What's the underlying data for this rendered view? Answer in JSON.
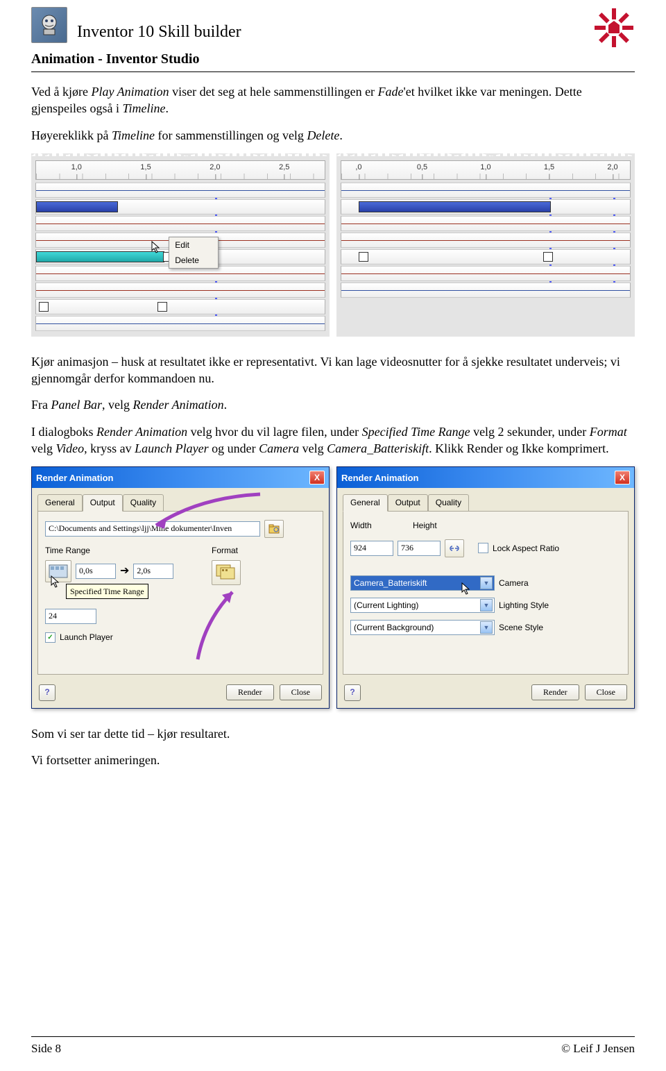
{
  "header": {
    "title": "Inventor 10  Skill builder",
    "subtitle": "Animation - Inventor Studio"
  },
  "body": {
    "p1a": "Ved å kjøre ",
    "p1_play": "Play Animation",
    "p1b": " viser det seg at hele sammenstillingen er ",
    "p1_fade": "Fade",
    "p1c": "'et hvilket ikke var meningen. Dette gjenspeiles også i ",
    "p1_timeline": "Timeline",
    "p1d": ".",
    "p2a": "Høyereklikk på ",
    "p2_timeline": "Timeline",
    "p2b": " for sammenstillingen og velg ",
    "p2_delete": "Delete",
    "p2c": ".",
    "p3": "Kjør animasjon – husk at resultatet ikke er representativt. Vi kan lage videosnutter for å sjekke resultatet underveis; vi gjennomgår derfor kommandoen nu.",
    "p4a": "Fra ",
    "p4_pb": "Panel Bar",
    "p4b": ", velg ",
    "p4_ra": "Render Animation",
    "p4c": ".",
    "p5a": "I dialogboks ",
    "p5_ra": "Render Animation",
    "p5b": " velg hvor du vil lagre filen, under ",
    "p5_str": "Specified Time Range",
    "p5c": " velg 2 sekunder, under ",
    "p5_fmt": "Format",
    "p5d": " velg ",
    "p5_vid": "Video",
    "p5e": ", kryss av ",
    "p5_lp": "Launch Player",
    "p5f": " og under ",
    "p5_cam": "Camera",
    "p5g": " velg ",
    "p5_cb": "Camera_Batteriskift",
    "p5h": ". Klikk Render og Ikke komprimert.",
    "p6": "Som vi ser tar dette tid – kjør resultaret.",
    "p7": "Vi fortsetter animeringen."
  },
  "timeline_left": {
    "ticks": [
      "1,0",
      "1,5",
      "2,0",
      "2,5"
    ],
    "menu": {
      "edit": "Edit",
      "delete": "Delete"
    }
  },
  "timeline_right": {
    "ticks": [
      ",0",
      "0,5",
      "1,0",
      "1,5",
      "2,0"
    ]
  },
  "dialog": {
    "title": "Render Animation",
    "tabs": {
      "general": "General",
      "output": "Output",
      "quality": "Quality"
    },
    "output": {
      "path": "C:\\Documents and Settings\\ljj\\Mine dokumenter\\Inven",
      "time_range_label": "Time Range",
      "format_label": "Format",
      "from": "0,0s",
      "to": "2,0s",
      "arrow": "➔",
      "fps": "24",
      "launch_player": "Launch Player",
      "tooltip": "Specified Time Range"
    },
    "general": {
      "width_label": "Width",
      "height_label": "Height",
      "width": "924",
      "height": "736",
      "lock": "Lock Aspect Ratio",
      "camera_val": "Camera_Batteriskift",
      "camera_lbl": "Camera",
      "lighting_val": "(Current Lighting)",
      "lighting_lbl": "Lighting Style",
      "scene_val": "(Current Background)",
      "scene_lbl": "Scene Style"
    },
    "buttons": {
      "render": "Render",
      "close": "Close",
      "help": "?",
      "x": "X"
    }
  },
  "footer": {
    "left": "Side 8",
    "right": "© Leif J Jensen"
  }
}
